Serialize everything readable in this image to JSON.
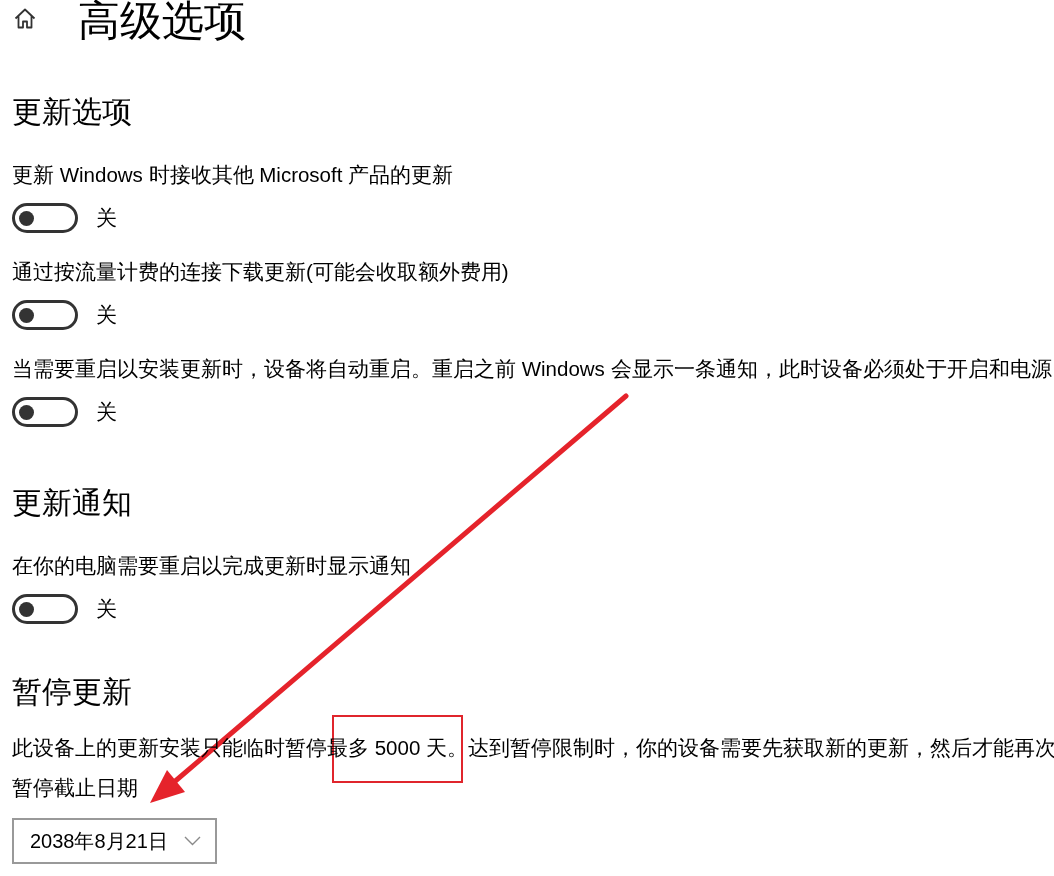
{
  "page": {
    "title": "高级选项"
  },
  "update_options": {
    "heading": "更新选项",
    "toggles": [
      {
        "label": "更新 Windows 时接收其他 Microsoft 产品的更新",
        "on": false,
        "state_text": "关"
      },
      {
        "label": "通过按流量计费的连接下载更新(可能会收取额外费用)",
        "on": false,
        "state_text": "关"
      },
      {
        "label": "当需要重启以安装更新时，设备将自动重启。重启之前 Windows 会显示一条通知，此时设备必须处于开启和电源",
        "on": false,
        "state_text": "关"
      }
    ]
  },
  "update_notifications": {
    "heading": "更新通知",
    "toggles": [
      {
        "label": "在你的电脑需要重启以完成更新时显示通知",
        "on": false,
        "state_text": "关"
      }
    ]
  },
  "pause_updates": {
    "heading": "暂停更新",
    "description": "此设备上的更新安装只能临时暂停最多 5000 天。达到暂停限制时，你的设备需要先获取新的更新，然后才能再次",
    "date_label": "暂停截止日期",
    "date_picker": {
      "value": "2038年8月21日"
    }
  },
  "annotations": [
    {
      "kind": "arrow"
    },
    {
      "kind": "highlight_frame"
    }
  ]
}
